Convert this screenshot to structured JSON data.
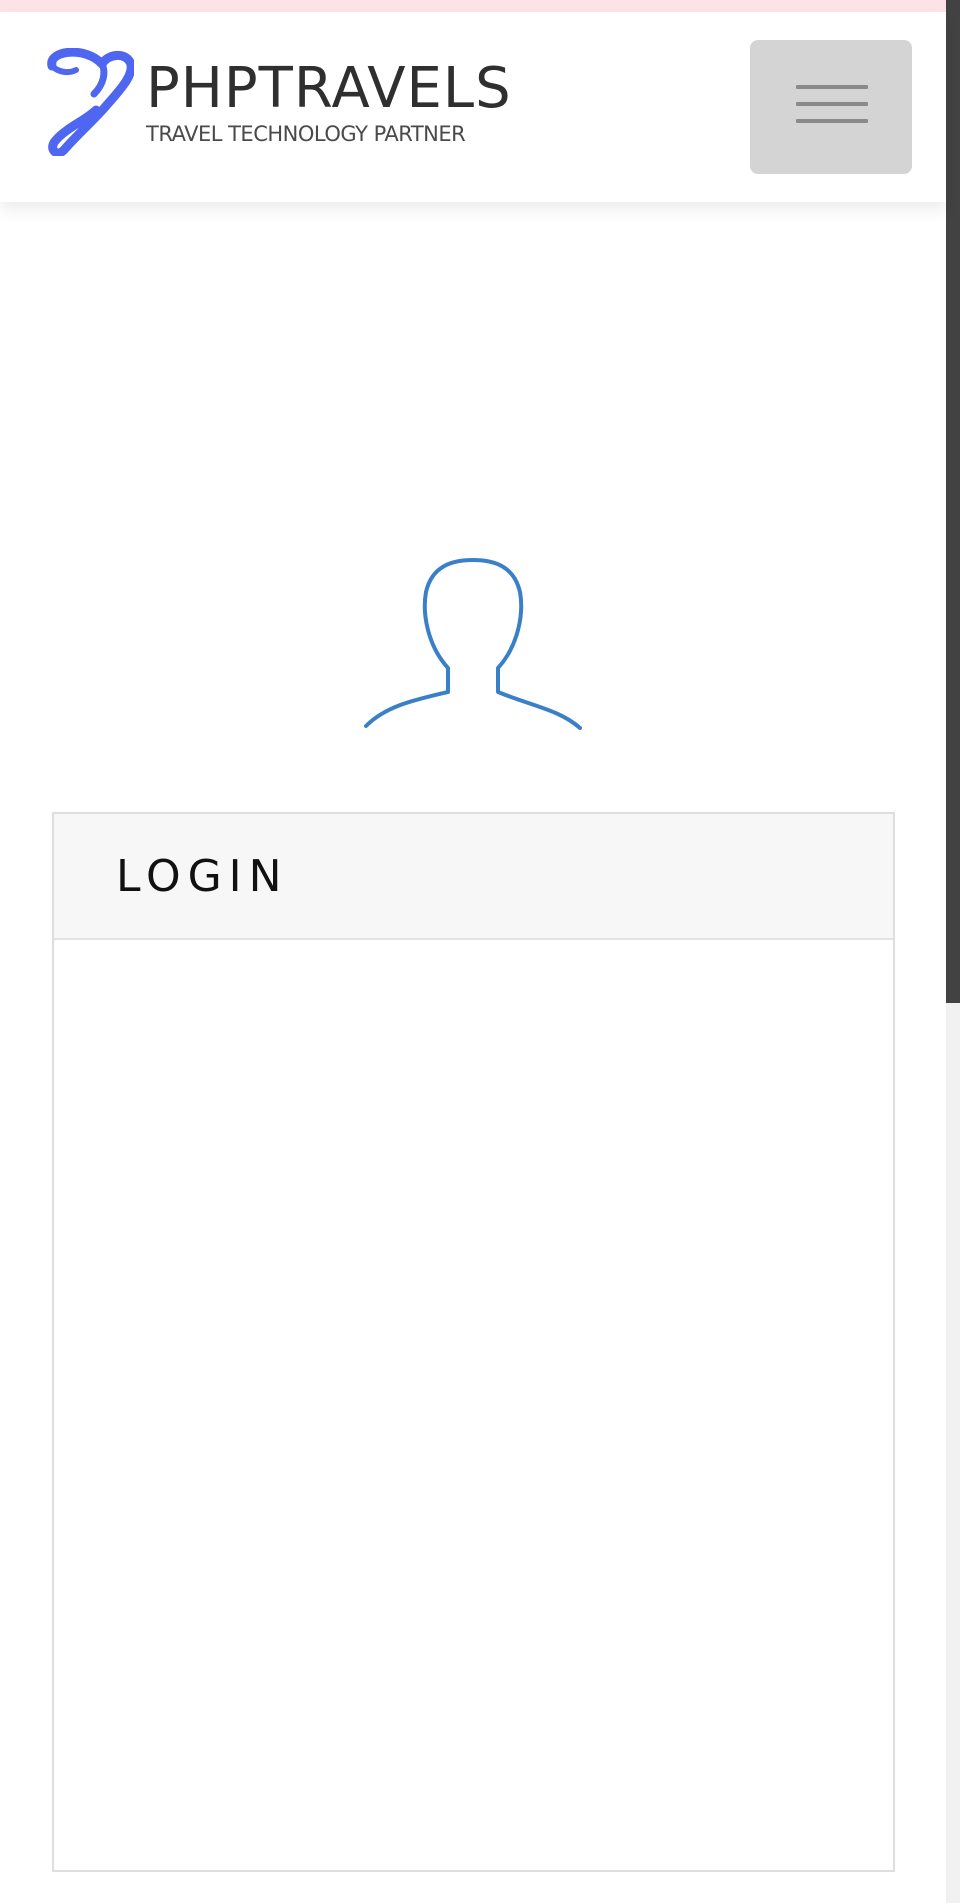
{
  "header": {
    "brand_name": "PHPTRAVELS",
    "brand_tagline": "TRAVEL TECHNOLOGY PARTNER",
    "logo_icon": "phptravels-logo-icon",
    "menu_icon": "hamburger-menu-icon"
  },
  "login": {
    "avatar_icon": "user-silhouette-icon",
    "title": "LOGIN"
  },
  "colors": {
    "alert_strip": "#fde3e5",
    "logo_blue": "#4f67f0",
    "avatar_blue": "#3a80c9",
    "menu_button_bg": "#d4d4d4",
    "panel_heading_bg": "#f7f7f7",
    "scrollbar_thumb": "#424242"
  }
}
